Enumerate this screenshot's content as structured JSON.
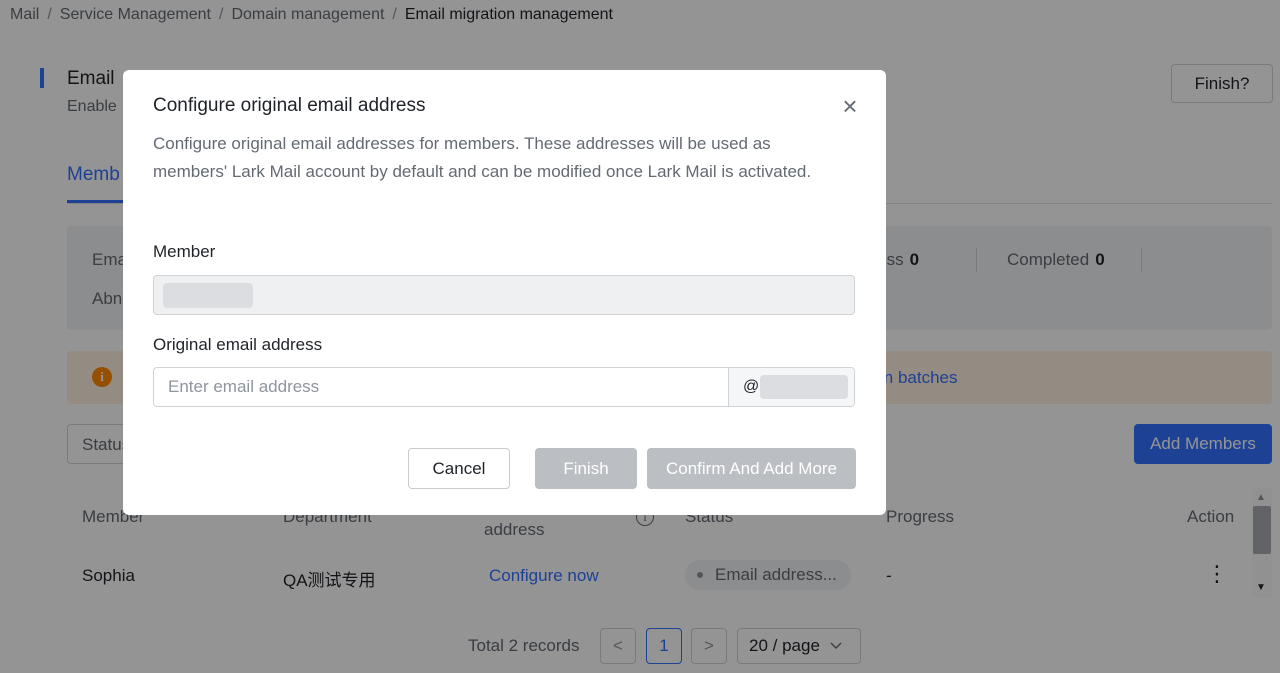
{
  "breadcrumb": {
    "items": [
      "Mail",
      "Service Management",
      "Domain management"
    ],
    "current": "Email migration management",
    "separator": "/"
  },
  "header": {
    "title": "Email",
    "subtitle": "Enable",
    "finish_button": "Finish?"
  },
  "tabs": {
    "active": "Memb"
  },
  "stats": {
    "email_label": "Ema",
    "abnormal_label": "Abn",
    "in_progress_label": "gress",
    "in_progress_value": "0",
    "completed_label": "Completed",
    "completed_value": "0"
  },
  "notice": {
    "link_text": "in batches"
  },
  "toolbar": {
    "status_filter": "Status",
    "add_members": "Add Members"
  },
  "table": {
    "headers": {
      "member": "Member",
      "department": "Department",
      "address": "address",
      "status": "Status",
      "progress": "Progress",
      "action": "Action"
    },
    "rows": [
      {
        "member": "Sophia",
        "department": "QA测试专用",
        "address": "Configure now",
        "status": "Email address...",
        "progress": "-"
      }
    ]
  },
  "pagination": {
    "total": "Total 2 records",
    "prev": "<",
    "current_page": "1",
    "next": ">",
    "page_size": "20 / page"
  },
  "modal": {
    "title": "Configure original email address",
    "close": "×",
    "description": "Configure original email addresses for members. These addresses will be used as members' Lark Mail account by default and can be modified once Lark Mail is activated.",
    "member_label": "Member",
    "email_label": "Original email address",
    "email_placeholder": "Enter email address",
    "at_sign": "@",
    "cancel_button": "Cancel",
    "finish_button": "Finish",
    "confirm_add_more_button": "Confirm And Add More"
  },
  "colors": {
    "accent": "#3370ff",
    "notice_bg": "#fff1e0",
    "notice_icon": "#ff8800",
    "disabled_button": "#bbbfc4"
  }
}
